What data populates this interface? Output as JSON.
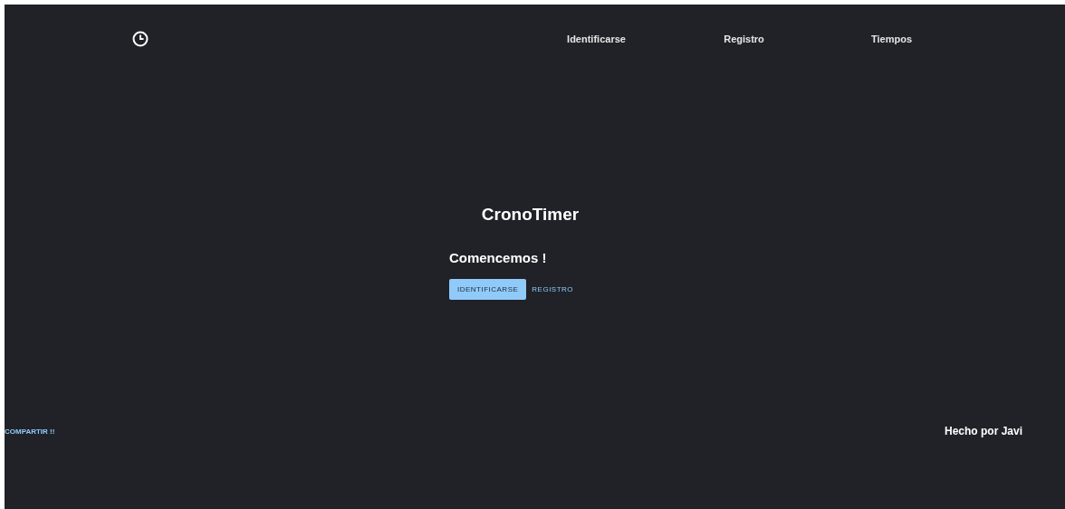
{
  "nav": {
    "links": [
      {
        "label": "Identificarse"
      },
      {
        "label": "Registro"
      },
      {
        "label": "Tiempos"
      }
    ]
  },
  "hero": {
    "title": "CronoTimer",
    "subtitle": "Comencemos !",
    "buttons": [
      {
        "label": "IDENTIFICARSE",
        "kind": "filled"
      },
      {
        "label": "REGISTRO",
        "kind": "text"
      }
    ]
  },
  "footer": {
    "share": "COMPARTIR !!",
    "credit": "Hecho por Javi"
  }
}
